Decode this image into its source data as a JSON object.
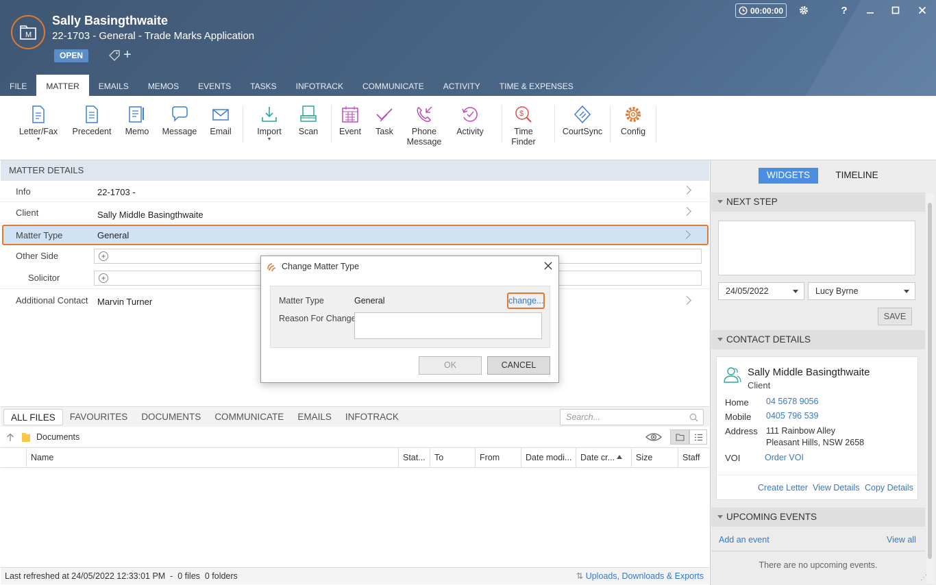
{
  "header": {
    "client_name": "Sally Basingthwaite",
    "matter_subtitle": "22-1703 - General - Trade Marks Application",
    "status": "OPEN",
    "timer": "00:00:00",
    "window_buttons": {
      "help": "?"
    }
  },
  "tabs": [
    "FILE",
    "MATTER",
    "EMAILS",
    "MEMOS",
    "EVENTS",
    "TASKS",
    "INFOTRACK",
    "COMMUNICATE",
    "ACTIVITY",
    "TIME & EXPENSES"
  ],
  "active_tab": "MATTER",
  "ribbon": {
    "letter_fax": "Letter/Fax",
    "precedent": "Precedent",
    "memo": "Memo",
    "message": "Message",
    "email": "Email",
    "import": "Import",
    "scan": "Scan",
    "event": "Event",
    "task": "Task",
    "phone_message": [
      "Phone",
      "Message"
    ],
    "activity": "Activity",
    "time_finder": [
      "Time",
      "Finder"
    ],
    "courtsync": "CourtSync",
    "config": "Config"
  },
  "matter_details": {
    "header": "MATTER DETAILS",
    "rows": [
      {
        "label": "Info",
        "value": "22-1703 -"
      },
      {
        "label": "Client",
        "value": "Sally Middle Basingthwaite"
      },
      {
        "label": "Matter Type",
        "value": "General"
      },
      {
        "label": "Other Side",
        "value": ""
      },
      {
        "label": "Solicitor",
        "value": ""
      },
      {
        "label": "Additional Contact",
        "value": "Marvin Turner"
      }
    ]
  },
  "dialog": {
    "title": "Change Matter Type",
    "matter_type_label": "Matter Type",
    "matter_type_value": "General",
    "change_link": "change...",
    "reason_label": "Reason For Change",
    "reason_value": "",
    "ok": "OK",
    "cancel": "CANCEL"
  },
  "documents": {
    "tabs": [
      "ALL FILES",
      "FAVOURITES",
      "DOCUMENTS",
      "COMMUNICATE",
      "EMAILS",
      "INFOTRACK"
    ],
    "search_placeholder": "Search...",
    "folder": "Documents",
    "columns": [
      "Name",
      "Stat...",
      "To",
      "From",
      "Date modi...",
      "Date cr...",
      "Size",
      "Staff"
    ],
    "status_text": "Last refreshed at 24/05/2022 12:33:01 PM  -  0 files  0 folders",
    "uploads_link": "Uploads, Downloads & Exports"
  },
  "right_panel": {
    "tab_widgets": "WIDGETS",
    "tab_timeline": "TIMELINE",
    "next_step": {
      "header": "NEXT STEP",
      "text": "",
      "date": "24/05/2022",
      "staff": "Lucy Byrne",
      "save": "SAVE"
    },
    "contact_details": {
      "header": "CONTACT DETAILS",
      "name": "Sally Middle Basingthwaite",
      "role": "Client",
      "home_label": "Home",
      "home": "04 5678 9056",
      "mobile_label": "Mobile",
      "mobile": "0405 796 539",
      "address_label": "Address",
      "address_line1": "111 Rainbow Alley",
      "address_line2": "Pleasant Hills, NSW 2658",
      "voi_label": "VOI",
      "voi_link": "Order VOI",
      "create_letter": "Create Letter",
      "view_details": "View Details",
      "copy_details": "Copy Details"
    },
    "upcoming_events": {
      "header": "UPCOMING EVENTS",
      "add": "Add an event",
      "view_all": "View all",
      "empty": "There are no upcoming events."
    }
  },
  "colors": {
    "header_bg": "#46607f",
    "accent_orange": "#e3782f",
    "link_blue": "#3479c7",
    "badge_blue": "#5b8ec9",
    "widgets_tab": "#4b8ee0"
  }
}
